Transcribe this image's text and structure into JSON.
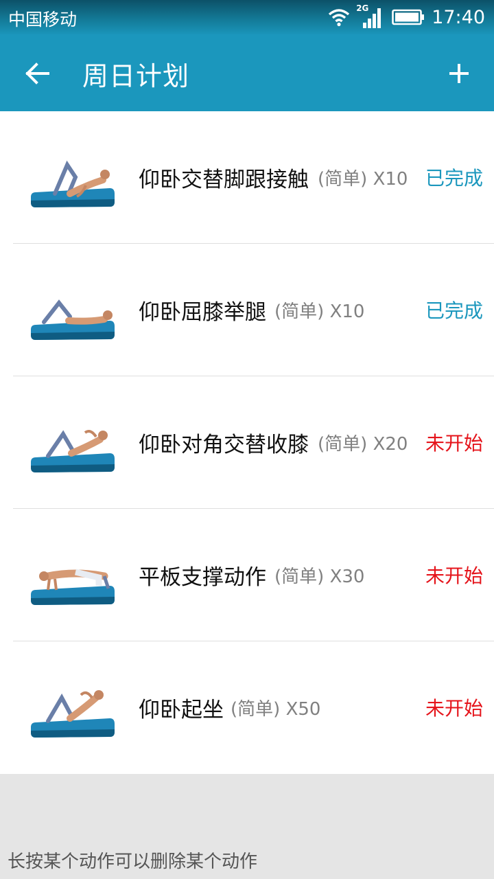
{
  "status_bar": {
    "carrier": "中国移动",
    "network": "2G",
    "time": "17:40"
  },
  "header": {
    "title": "周日计划",
    "back_icon": "arrow-left-icon",
    "add_icon": "plus-icon"
  },
  "exercises": [
    {
      "name": "仰卧交替脚跟接触",
      "level": "(简单)",
      "reps": "X10",
      "status": "已完成",
      "status_color": "#1b97bd"
    },
    {
      "name": "仰卧屈膝举腿",
      "level": "(简单)",
      "reps": "X10",
      "status": "已完成",
      "status_color": "#1b97bd"
    },
    {
      "name": "仰卧对角交替收膝",
      "level": "(简单)",
      "reps": "X20",
      "status": "未开始",
      "status_color": "#e5141b"
    },
    {
      "name": "平板支撑动作",
      "level": "(简单)",
      "reps": "X30",
      "status": "未开始",
      "status_color": "#e5141b"
    },
    {
      "name": "仰卧起坐",
      "level": "(简单)",
      "reps": "X50",
      "status": "未开始",
      "status_color": "#e5141b"
    }
  ],
  "footer": {
    "hint": "长按某个动作可以删除某个动作"
  },
  "colors": {
    "accent": "#1b97bd",
    "not_started": "#e5141b",
    "mat": "#1f86b8"
  }
}
